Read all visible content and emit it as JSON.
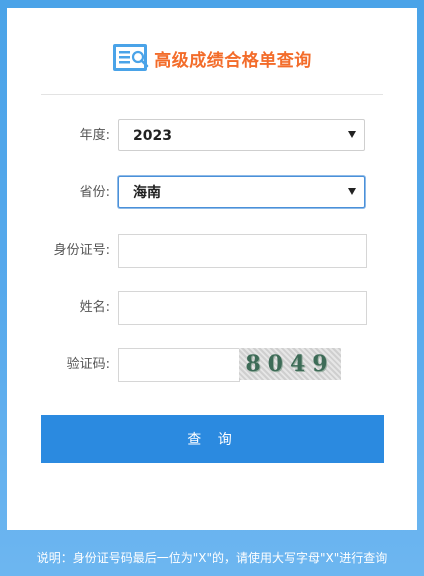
{
  "header": {
    "title": "高级成绩合格单查询",
    "logo_icon": "document-search-icon"
  },
  "form": {
    "year": {
      "label": "年度:",
      "value": "2023"
    },
    "province": {
      "label": "省份:",
      "value": "海南"
    },
    "id_number": {
      "label": "身份证号:",
      "value": ""
    },
    "name": {
      "label": "姓名:",
      "value": ""
    },
    "captcha": {
      "label": "验证码:",
      "value": "",
      "code": "8049"
    }
  },
  "submit_label": "查 询",
  "footer_note": "说明：身份证号码最后一位为\"X\"的，请使用大写字母\"X\"进行查询",
  "colors": {
    "title": "#f36c2a",
    "button": "#2b8ae0",
    "background": "#56a9ec"
  }
}
